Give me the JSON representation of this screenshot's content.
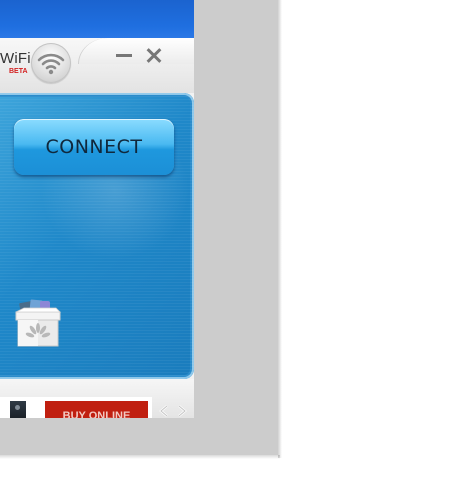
{
  "app": {
    "brand_text": "WiFi",
    "beta_label": "BETA"
  },
  "window_controls": {
    "minimize": "minimize",
    "close": "close"
  },
  "main": {
    "connect_label": "CONNECT"
  },
  "ad": {
    "buy_online_label": "BUY ONLINE"
  },
  "icons": [
    "wifi-signal-icon",
    "gift-box-icon",
    "chevron-left-icon",
    "chevron-right-icon"
  ],
  "colors": {
    "top_bar": "#1f6fe0",
    "panel": "#1f88c9",
    "connect_button": "#49b9f1",
    "ad_button": "#c01f10",
    "beta": "#d32020"
  }
}
